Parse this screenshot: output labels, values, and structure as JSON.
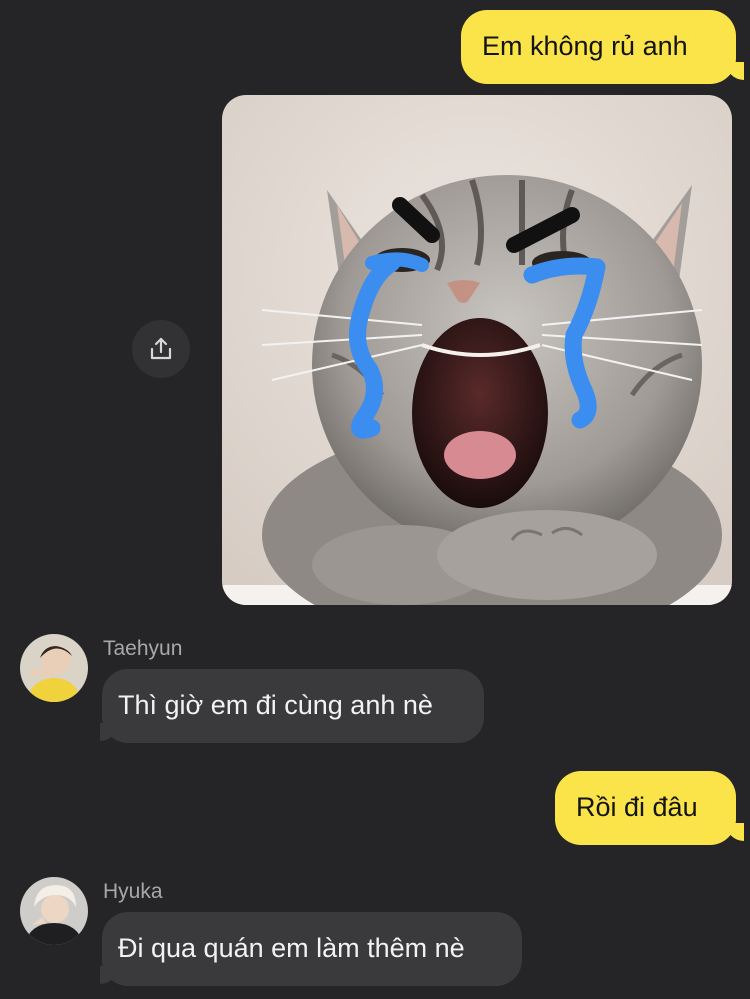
{
  "messages": [
    {
      "sender": "",
      "text": "Em không rủ anh",
      "side": "me"
    },
    {
      "sender": "",
      "type": "image",
      "description_icon": "crying-cat-photo",
      "side": "me"
    },
    {
      "sender": "Taehyun",
      "text": "Thì giờ em đi cùng anh nè",
      "side": "them"
    },
    {
      "sender": "",
      "text": "Rồi đi đâu",
      "side": "me"
    },
    {
      "sender": "Hyuka",
      "text": "Đi qua quán em làm thêm nè",
      "side": "them"
    }
  ],
  "share_icon": "share-icon",
  "colors": {
    "background": "#252527",
    "my_bubble": "#fbe34a",
    "their_bubble": "#3a3a3c",
    "sender_name": "#a8a8ac",
    "tear_blue": "#3b8df0"
  }
}
